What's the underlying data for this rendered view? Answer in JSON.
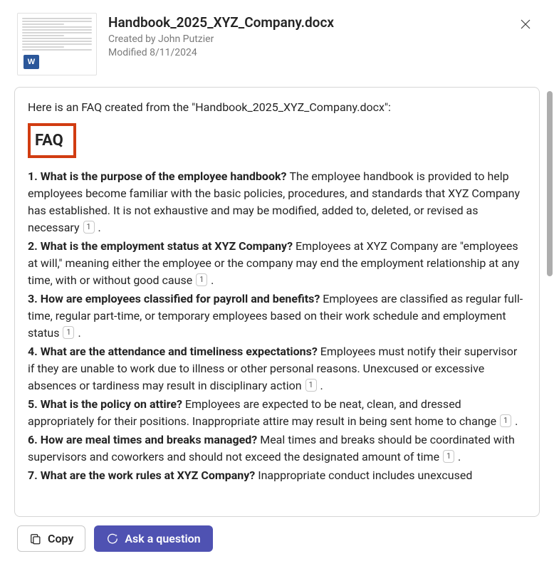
{
  "header": {
    "title": "Handbook_2025_XYZ_Company.docx",
    "created_by_label": "Created by",
    "created_by": "John Putzier",
    "modified_label": "Modified",
    "modified": "8/11/2024",
    "doc_icon": "word-icon",
    "close_icon": "close-icon"
  },
  "response": {
    "intro": "Here is an FAQ created from the \"Handbook_2025_XYZ_Company.docx\":",
    "heading": "FAQ",
    "items": [
      {
        "num": "1.",
        "q": "What is the purpose of the employee handbook?",
        "a": "The employee handbook is provided to help employees become familiar with the basic policies, procedures, and standards that XYZ Company has established. It is not exhaustive and may be modified, added to, deleted, or revised as necessary",
        "cite": "1"
      },
      {
        "num": "2.",
        "q": "What is the employment status at XYZ Company?",
        "a": "Employees at XYZ Company are \"employees at will,\" meaning either the employee or the company may end the employment relationship at any time, with or without good cause",
        "cite": "1"
      },
      {
        "num": "3.",
        "q": "How are employees classified for payroll and benefits?",
        "a": "Employees are classified as regular full-time, regular part-time, or temporary employees based on their work schedule and employment status",
        "cite": "1"
      },
      {
        "num": "4.",
        "q": "What are the attendance and timeliness expectations?",
        "a": "Employees must notify their supervisor if they are unable to work due to illness or other personal reasons. Unexcused or excessive absences or tardiness may result in disciplinary action",
        "cite": "1"
      },
      {
        "num": "5.",
        "q": "What is the policy on attire?",
        "a": "Employees are expected to be neat, clean, and dressed appropriately for their positions. Inappropriate attire may result in being sent home to change",
        "cite": "1"
      },
      {
        "num": "6.",
        "q": "How are meal times and breaks managed?",
        "a": "Meal times and breaks should be coordinated with supervisors and coworkers and should not exceed the designated amount of time",
        "cite": "1"
      },
      {
        "num": "7.",
        "q": "What are the work rules at XYZ Company?",
        "a": "Inappropriate conduct includes unexcused",
        "cite": ""
      }
    ]
  },
  "footer": {
    "copy_label": "Copy",
    "ask_label": "Ask a question",
    "copy_icon": "copy-icon",
    "ask_icon": "chat-sparkle-icon"
  }
}
